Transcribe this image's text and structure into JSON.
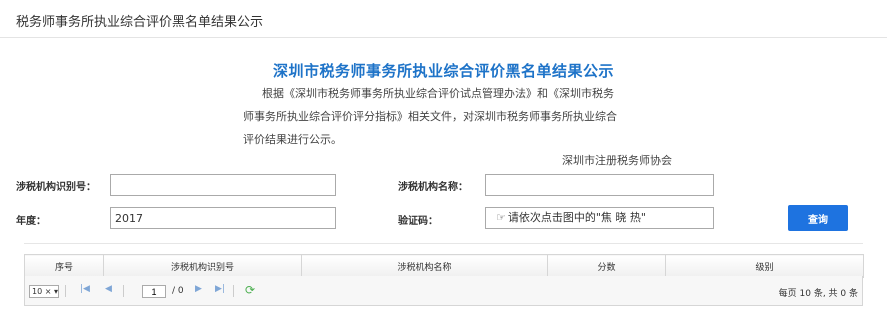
{
  "header": {
    "title": "税务师事务所执业综合评价黑名单结果公示"
  },
  "notice": {
    "title": "深圳市税务师事务所执业综合评价黑名单结果公示",
    "lines": [
      "根据《深圳市税务师事务所执业综合评价试点管理办法》和《深圳市税务",
      "师事务所执业综合评价评分指标》相关文件，对深圳市税务师事务所执业综合",
      "评价结果进行公示。"
    ],
    "signature": "深圳市注册税务师协会"
  },
  "form": {
    "org_id_label": "涉税机构识别号：",
    "org_id_value": "",
    "org_name_label": "涉税机构名称：",
    "org_name_value": "",
    "year_label": "年度：",
    "year_value": "2017",
    "captcha_label": "验证码：",
    "captcha_icon": "pointing-hand-icon",
    "captcha_hint": "请依次点击图中的\"焦 晓 热\"",
    "query_button": "查询"
  },
  "table": {
    "columns": [
      "序号",
      "涉税机构识别号",
      "涉税机构名称",
      "分数",
      "级别"
    ],
    "rows": []
  },
  "pager": {
    "page_size": "10 ×",
    "current_page": "1",
    "total_pages": "/ 0",
    "summary": "每页 10 条, 共 0 条"
  },
  "colors": {
    "accent": "#1e73c8",
    "button": "#1e73e0"
  }
}
